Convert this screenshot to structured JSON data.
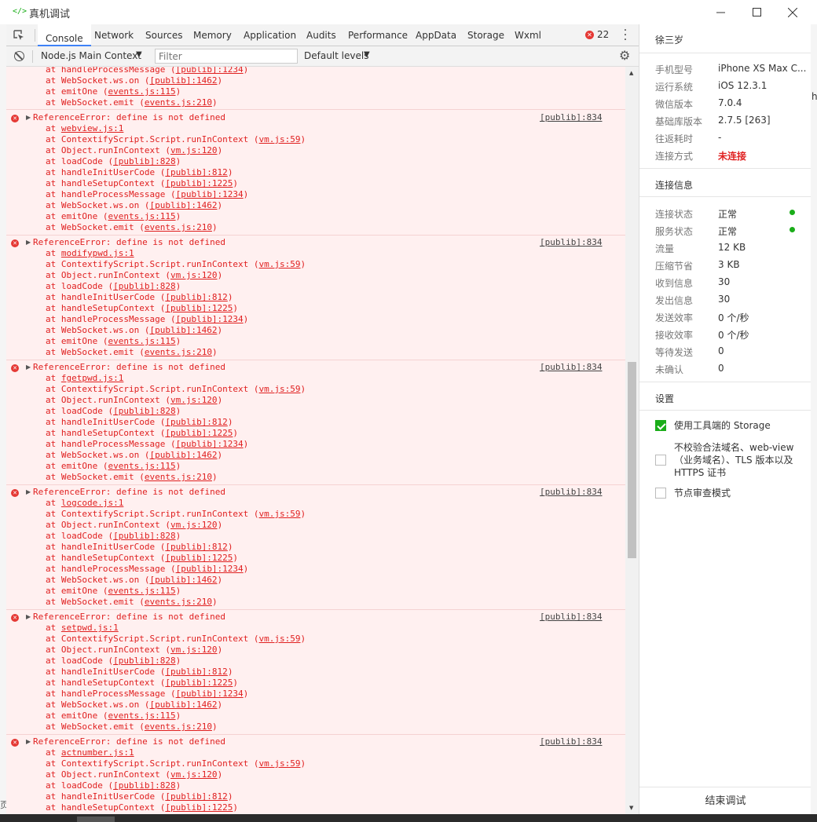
{
  "window": {
    "title": "真机调试",
    "icon": "code-icon",
    "controls": [
      "minimize",
      "maximize",
      "close"
    ]
  },
  "tabs": [
    "Console",
    "Network",
    "Sources",
    "Memory",
    "Application",
    "Audits",
    "Performance",
    "AppData",
    "Storage",
    "Wxml"
  ],
  "active_tab": "Console",
  "error_count": "22",
  "toolbar": {
    "context": "Node.js Main Context",
    "filter_placeholder": "Filter",
    "levels": "Default levels"
  },
  "log": {
    "partial_top": [
      {
        "at": "at handleProcessMessage (",
        "link": "[publib]:1234",
        "end": ")"
      },
      {
        "at": "at WebSocket.ws.on (",
        "link": "[publib]:1462",
        "end": ")"
      },
      {
        "at": "at emitOne (",
        "link": "events.js:115",
        "end": ")"
      },
      {
        "at": "at WebSocket.emit (",
        "link": "events.js:210",
        "end": ")"
      }
    ],
    "error_text": "ReferenceError: define is not defined",
    "source": "[publib]:834",
    "errors": [
      {
        "file": "webview.js:1"
      },
      {
        "file": "modifypwd.js:1"
      },
      {
        "file": "fgetpwd.js:1"
      },
      {
        "file": "logcode.js:1"
      },
      {
        "file": "setpwd.js:1"
      },
      {
        "file": "actnumber.js:1"
      }
    ],
    "stack": [
      {
        "at": "at ContextifyScript.Script.runInContext (",
        "link": "vm.js:59",
        "end": ")"
      },
      {
        "at": "at Object.runInContext (",
        "link": "vm.js:120",
        "end": ")"
      },
      {
        "at": "at loadCode (",
        "link": "[publib]:828",
        "end": ")"
      },
      {
        "at": "at handleInitUserCode (",
        "link": "[publib]:812",
        "end": ")"
      },
      {
        "at": "at handleSetupContext (",
        "link": "[publib]:1225",
        "end": ")"
      },
      {
        "at": "at handleProcessMessage (",
        "link": "[publib]:1234",
        "end": ")"
      },
      {
        "at": "at WebSocket.ws.on (",
        "link": "[publib]:1462",
        "end": ")"
      },
      {
        "at": "at emitOne (",
        "link": "events.js:115",
        "end": ")"
      },
      {
        "at": "at WebSocket.emit (",
        "link": "events.js:210",
        "end": ")"
      }
    ]
  },
  "panel": {
    "user": "徐三岁",
    "device": [
      {
        "label": "手机型号",
        "value": "iPhone XS Max C..."
      },
      {
        "label": "运行系统",
        "value": "iOS 12.3.1"
      },
      {
        "label": "微信版本",
        "value": "7.0.4"
      },
      {
        "label": "基础库版本",
        "value": "2.7.5 [263]"
      },
      {
        "label": "往返耗时",
        "value": "-"
      },
      {
        "label": "连接方式",
        "value": "未连接"
      }
    ],
    "conn_title": "连接信息",
    "conn": [
      {
        "label": "连接状态",
        "value": "正常"
      },
      {
        "label": "服务状态",
        "value": "正常"
      },
      {
        "label": "流量",
        "value": "12 KB"
      },
      {
        "label": "压缩节省",
        "value": "3 KB"
      },
      {
        "label": "收到信息",
        "value": "30"
      },
      {
        "label": "发出信息",
        "value": "30"
      },
      {
        "label": "发送效率",
        "value": "0 个/秒"
      },
      {
        "label": "接收效率",
        "value": "0 个/秒"
      },
      {
        "label": "等待发送",
        "value": "0"
      },
      {
        "label": "未确认",
        "value": "0"
      }
    ],
    "settings_title": "设置",
    "settings": [
      {
        "label": "使用工具端的 Storage",
        "checked": true
      },
      {
        "label": "不校验合法域名、web-view（业务域名）、TLS 版本以及 HTTPS 证书",
        "checked": false
      },
      {
        "label": "节点审查模式",
        "checked": false
      }
    ],
    "end_button": "结束调试"
  },
  "colors": {
    "accent": "#1aad19",
    "error": "#e02020",
    "error_bg": "#fff0f0",
    "disconnected": "#e02020"
  },
  "edge_text": {
    "right": "h",
    "left": "页"
  }
}
